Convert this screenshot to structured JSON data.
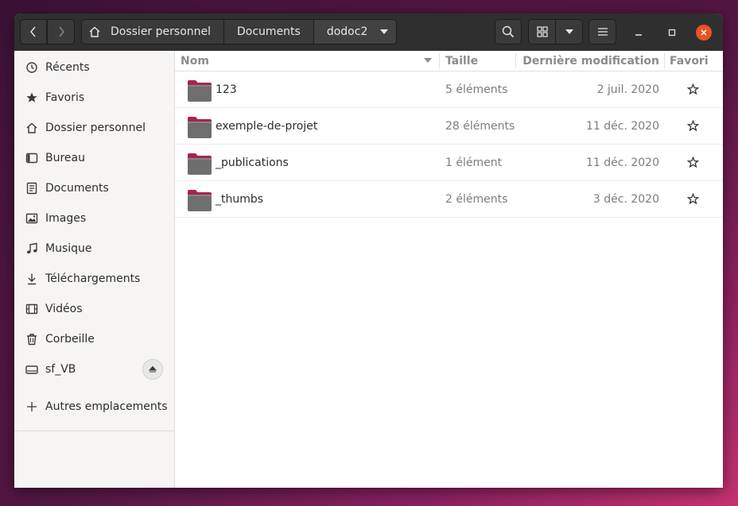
{
  "header": {
    "breadcrumbs": [
      "Dossier personnel",
      "Documents",
      "dodoc2"
    ],
    "icons": {
      "back": "chevron-left-icon",
      "forward": "chevron-right-icon",
      "home": "home-icon",
      "path_dropdown": "triangle-down-icon",
      "search": "search-icon",
      "grid_view": "grid-view-icon",
      "view_options": "triangle-down-icon",
      "menu": "hamburger-menu-icon",
      "minimize": "minimize-icon",
      "maximize": "maximize-icon",
      "close": "close-icon"
    }
  },
  "sidebar": {
    "items": [
      {
        "label": "Récents",
        "icon": "clock-icon"
      },
      {
        "label": "Favoris",
        "icon": "star-icon"
      },
      {
        "label": "Dossier personnel",
        "icon": "home-icon"
      },
      {
        "label": "Bureau",
        "icon": "desktop-icon"
      },
      {
        "label": "Documents",
        "icon": "document-icon"
      },
      {
        "label": "Images",
        "icon": "image-icon"
      },
      {
        "label": "Musique",
        "icon": "music-icon"
      },
      {
        "label": "Téléchargements",
        "icon": "download-icon"
      },
      {
        "label": "Vidéos",
        "icon": "video-icon"
      },
      {
        "label": "Corbeille",
        "icon": "trash-icon"
      },
      {
        "label": "sf_VB",
        "icon": "drive-icon",
        "eject_icon": "eject-icon"
      }
    ],
    "other_locations": {
      "label": "Autres emplacements",
      "icon": "plus-icon"
    }
  },
  "columns": {
    "name": "Nom",
    "size": "Taille",
    "modified": "Dernière modification",
    "starred": "Favori",
    "sort_icon": "sort-down-icon"
  },
  "files": [
    {
      "name": "123",
      "size": "5 éléments",
      "modified": "2 juil. 2020"
    },
    {
      "name": "exemple-de-projet",
      "size": "28 éléments",
      "modified": "11 déc. 2020"
    },
    {
      "name": "_publications",
      "size": "1 élément",
      "modified": "11 déc. 2020"
    },
    {
      "name": "_thumbs",
      "size": "2 éléments",
      "modified": "3 déc. 2020"
    }
  ],
  "colors": {
    "headerbar": "#2f2f2f",
    "close_button": "#e95420",
    "folder_body": "#6e6e6e",
    "folder_tab": "#a6244e"
  }
}
